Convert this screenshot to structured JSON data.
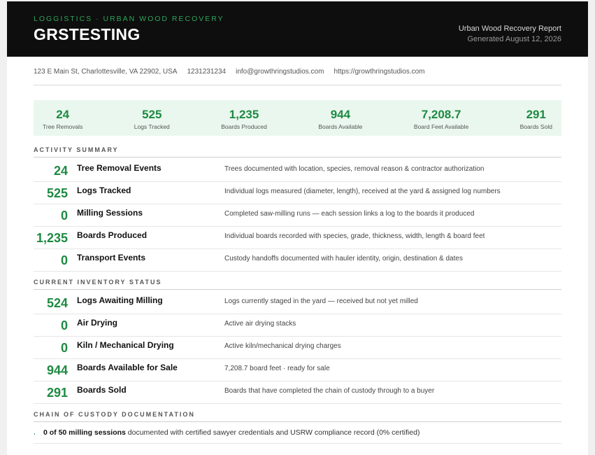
{
  "header": {
    "kicker": "LOGGISTICS · URBAN WOOD RECOVERY",
    "title": "GRSTESTING",
    "report_name": "Urban Wood Recovery Report",
    "generated": "Generated August 12, 2026"
  },
  "contact": {
    "address": "123 E Main St, Charlottesville, VA 22902, USA",
    "phone": "1231231234",
    "email": "info@growthringstudios.com",
    "website": "https://growthringstudios.com"
  },
  "stats": [
    {
      "value": "24",
      "label": "Tree Removals"
    },
    {
      "value": "525",
      "label": "Logs Tracked"
    },
    {
      "value": "1,235",
      "label": "Boards Produced"
    },
    {
      "value": "944",
      "label": "Boards Available"
    },
    {
      "value": "7,208.7",
      "label": "Board Feet Available"
    },
    {
      "value": "291",
      "label": "Boards Sold"
    }
  ],
  "activity": {
    "title": "ACTIVITY SUMMARY",
    "rows": [
      {
        "value": "24",
        "label": "Tree Removal Events",
        "desc": "Trees documented with location, species, removal reason & contractor authorization"
      },
      {
        "value": "525",
        "label": "Logs Tracked",
        "desc": "Individual logs measured (diameter, length), received at the yard & assigned log numbers"
      },
      {
        "value": "0",
        "label": "Milling Sessions",
        "desc": "Completed saw-milling runs — each session links a log to the boards it produced"
      },
      {
        "value": "1,235",
        "label": "Boards Produced",
        "desc": "Individual boards recorded with species, grade, thickness, width, length & board feet"
      },
      {
        "value": "0",
        "label": "Transport Events",
        "desc": "Custody handoffs documented with hauler identity, origin, destination & dates"
      }
    ]
  },
  "inventory": {
    "title": "CURRENT INVENTORY STATUS",
    "rows": [
      {
        "value": "524",
        "label": "Logs Awaiting Milling",
        "desc": "Logs currently staged in the yard — received but not yet milled"
      },
      {
        "value": "0",
        "label": "Air Drying",
        "desc": "Active air drying stacks"
      },
      {
        "value": "0",
        "label": "Kiln / Mechanical Drying",
        "desc": "Active kiln/mechanical drying charges"
      },
      {
        "value": "944",
        "label": "Boards Available for Sale",
        "desc": "7,208.7 board feet · ready for sale"
      },
      {
        "value": "291",
        "label": "Boards Sold",
        "desc": "Boards that have completed the chain of custody through to a buyer"
      }
    ]
  },
  "custody": {
    "title": "CHAIN OF CUSTODY DOCUMENTATION",
    "mark": ",",
    "bold": "0 of 50 milling sessions",
    "rest": " documented with certified sawyer credentials and USRW compliance record (0% certified)"
  }
}
